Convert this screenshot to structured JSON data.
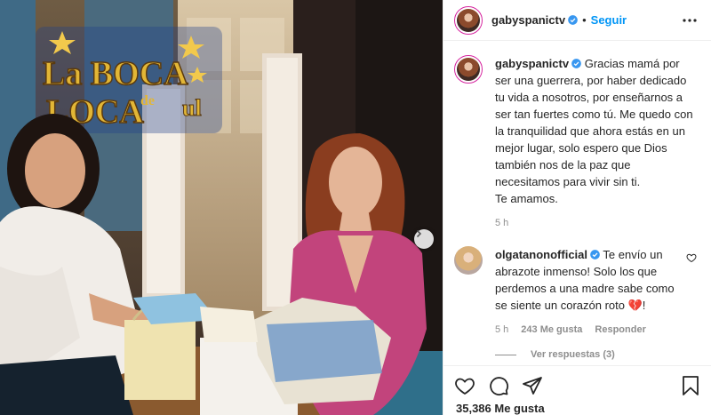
{
  "post": {
    "username": "gabyspanictv",
    "follow_label": "Seguir",
    "separator": "•",
    "photo": {
      "sign_text_line1": "La BOCA",
      "sign_text_line2": "LOCA",
      "sign_text_small": "de",
      "sign_text_tail": "ul"
    },
    "caption": {
      "username": "gabyspanictv",
      "text": "Gracias mamá por ser una guerrera, por haber dedicado tu vida a nosotros, por enseñarnos a ser tan fuertes como tú. Me quedo con la tranquilidad que ahora estás en un mejor lugar, solo espero que Dios también nos de la paz que necesitamos para vivir sin ti.",
      "text2": "Te amamos.",
      "time": "5 h"
    },
    "comment": {
      "username": "olgatanonofficial",
      "text": "Te envío un abrazote inmenso! Solo los que perdemos a una madre sabe como se siente un corazón roto 💔!",
      "time": "5 h",
      "likes": "243 Me gusta",
      "reply_label": "Responder",
      "view_replies": "Ver respuestas (3)"
    },
    "likes_count": "35,386 Me gusta"
  },
  "icons": {
    "more": "more-horizontal-icon",
    "heart": "heart-icon",
    "comment": "comment-icon",
    "share": "share-icon",
    "save": "bookmark-icon",
    "next": "chevron-right-icon",
    "verified": "verified-badge-icon"
  },
  "colors": {
    "accent": "#0095f6",
    "verified": "#3897f0",
    "muted": "#8e8e8e",
    "border": "#efefef"
  }
}
